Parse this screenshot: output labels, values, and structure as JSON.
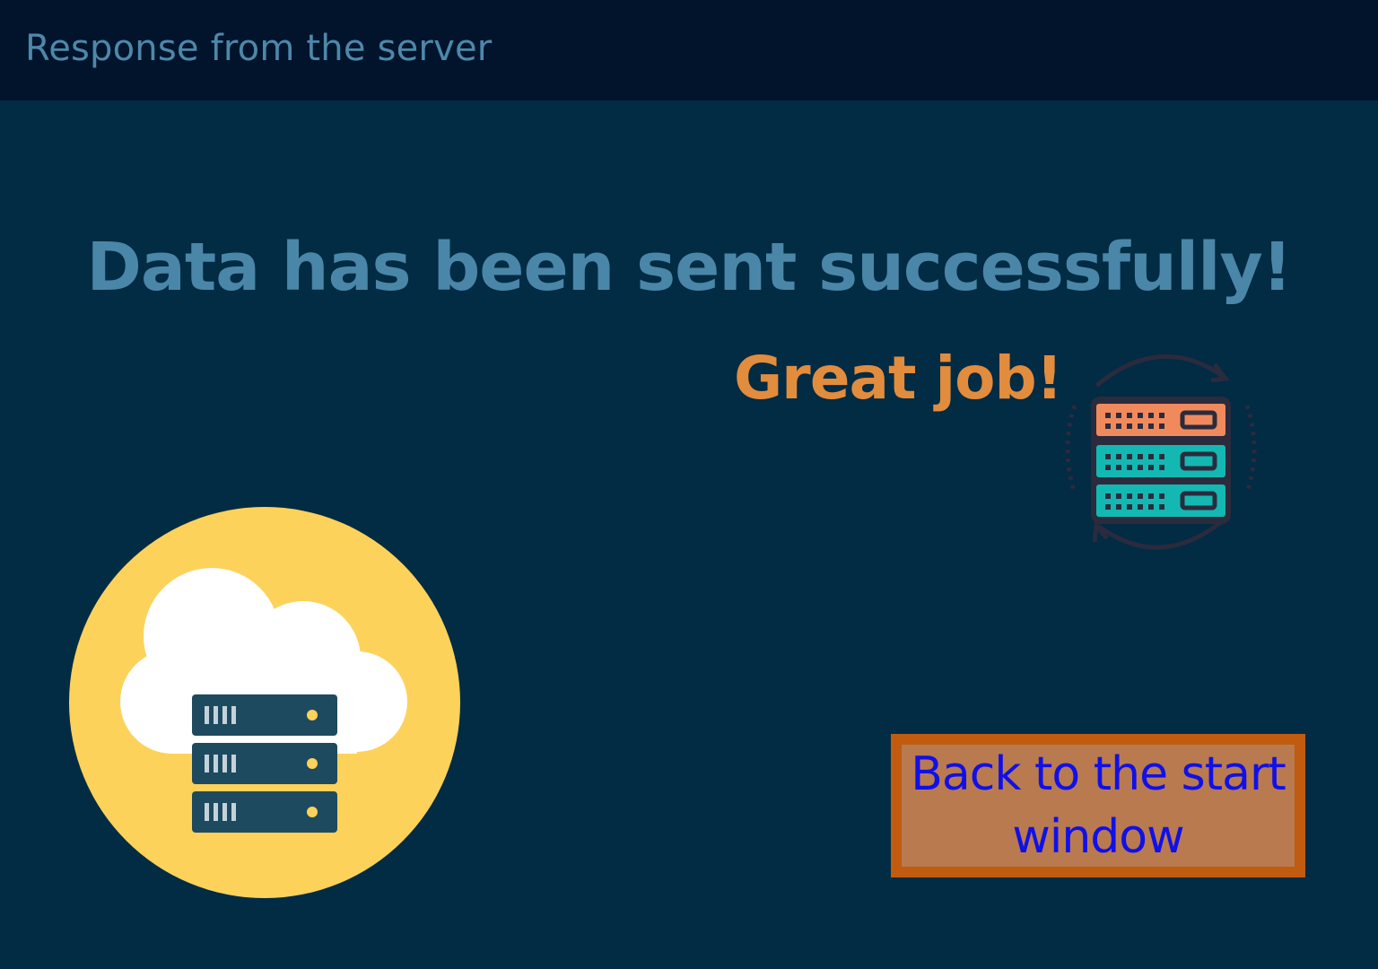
{
  "window": {
    "title": "Response from the server"
  },
  "message": {
    "headline": "Data has been sent successfully!",
    "praise": "Great job!"
  },
  "icons": {
    "server_sync": "server-sync-icon",
    "cloud_server": "cloud-server-icon"
  },
  "actions": {
    "back_label": "Back to the start window"
  },
  "colors": {
    "background": "#022b44",
    "titlebar": "#01142b",
    "headline": "#4a86a8",
    "praise": "#e28c3e",
    "button_border": "#c05b0f",
    "button_fill": "#b97a4f",
    "button_text": "#1010e8"
  }
}
